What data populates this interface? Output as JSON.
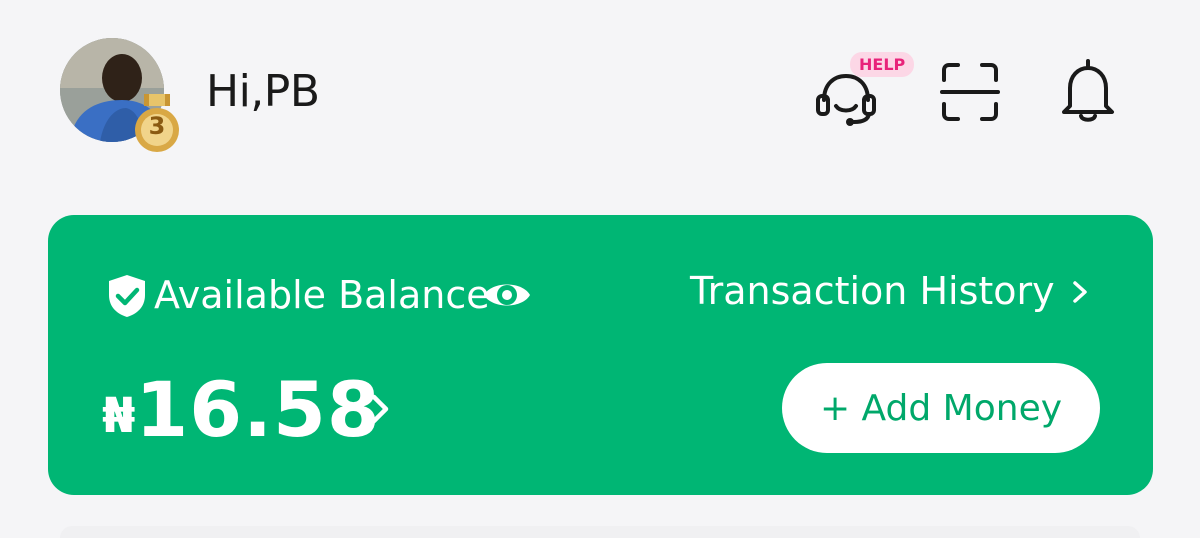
{
  "header": {
    "greeting": "Hi,PB",
    "medal_level": "3",
    "help_badge": "HELP",
    "icons": [
      "headset-icon",
      "scan-icon",
      "bell-icon"
    ]
  },
  "balance_card": {
    "label": "Available Balance",
    "currency_symbol": "₦",
    "amount": "16.58",
    "transaction_history_label": "Transaction History",
    "add_money_label": "+ Add Money",
    "icons": [
      "shield-check-icon",
      "eye-icon",
      "chevron-right-icon"
    ]
  },
  "colors": {
    "primary_green": "#00b674",
    "help_pink": "#e8237a",
    "help_badge_bg": "#fcd7e6",
    "background": "#f5f5f7",
    "medal_gold": "#e2b04a"
  }
}
